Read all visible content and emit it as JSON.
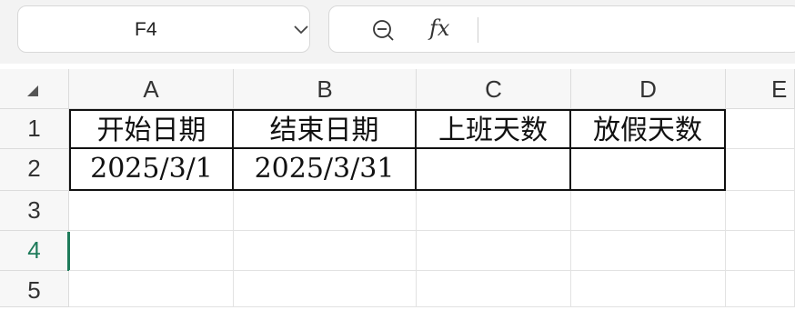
{
  "name_box": {
    "value": "F4"
  },
  "formula_bar": {
    "fx_label": "fx",
    "content": ""
  },
  "columns": [
    "A",
    "B",
    "C",
    "D",
    "E"
  ],
  "rows": [
    "1",
    "2",
    "3",
    "4",
    "5"
  ],
  "active_cell": "F4",
  "cells": {
    "A1": "开始日期",
    "B1": "结束日期",
    "C1": "上班天数",
    "D1": "放假天数",
    "A2": "2025/3/1",
    "B2": "2025/3/31",
    "C2": "",
    "D2": ""
  }
}
